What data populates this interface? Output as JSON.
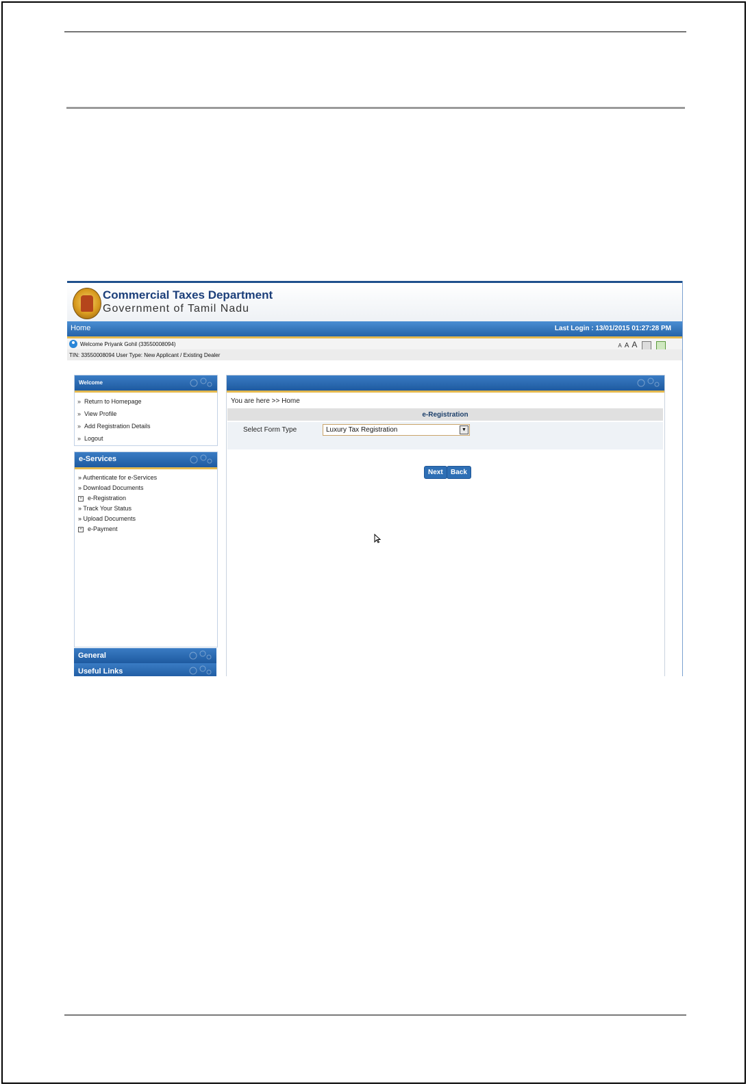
{
  "header": {
    "title": "Commercial Taxes Department",
    "subtitle": "Government of Tamil Nadu"
  },
  "nav": {
    "home": "Home",
    "last_login": "Last Login : 13/01/2015 01:27:28 PM"
  },
  "user": {
    "welcome": "Welcome Priyank Gohil (33550008094)",
    "tin_line": "TIN: 33550008094    User Type: New Applicant / Existing Dealer",
    "font_sizes": [
      "A",
      "A",
      "A"
    ]
  },
  "sidebar": {
    "welcome": {
      "title": "Welcome",
      "items": [
        "Return to Homepage",
        "View Profile",
        "Add Registration Details",
        "Logout"
      ]
    },
    "eservices": {
      "title": "e-Services",
      "items": [
        {
          "label": "Authenticate for e-Services",
          "type": "link"
        },
        {
          "label": "Download Documents",
          "type": "link"
        },
        {
          "label": "e-Registration",
          "type": "expand"
        },
        {
          "label": "Track Your Status",
          "type": "link"
        },
        {
          "label": "Upload Documents",
          "type": "link"
        },
        {
          "label": "e-Payment",
          "type": "expand"
        }
      ]
    },
    "general": {
      "title": "General"
    },
    "useful": {
      "title": "Useful Links"
    }
  },
  "main": {
    "breadcrumb": "You are here >> Home",
    "form_title": "e-Registration",
    "form_label": "Select Form Type",
    "selected_form": "Luxury Tax Registration",
    "next_label": "Next",
    "back_label": "Back"
  },
  "colors": {
    "brand_blue": "#2563a8",
    "accent_gold": "#e4b94f"
  }
}
